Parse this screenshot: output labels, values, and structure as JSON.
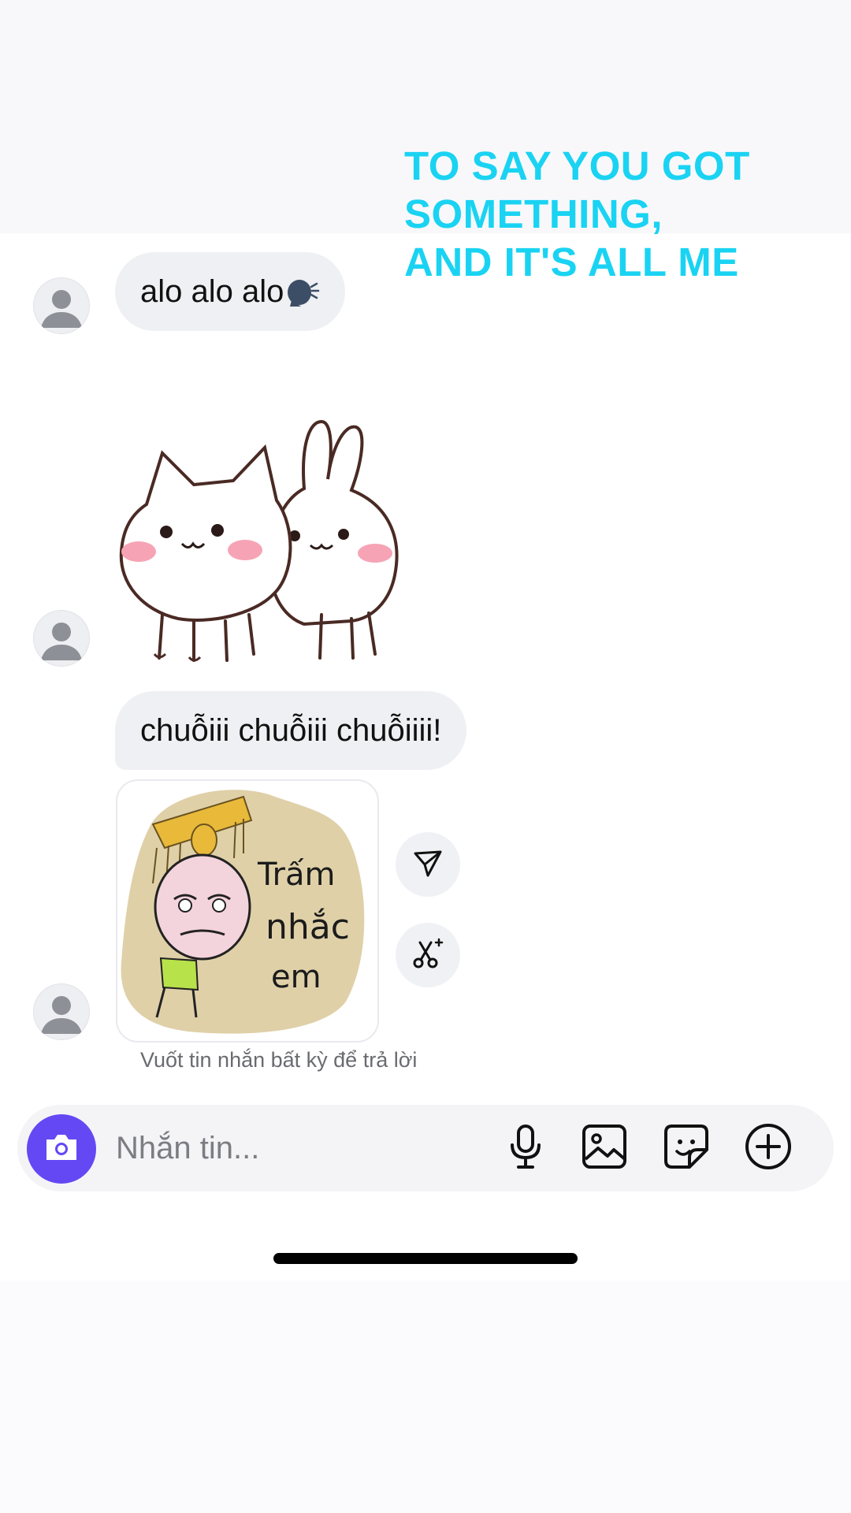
{
  "overlay_caption": {
    "line1": "TO SAY YOU GOT",
    "line2": "SOMETHING,",
    "line3": "AND IT'S ALL ME"
  },
  "messages": [
    {
      "type": "text",
      "text": "alo alo alo",
      "emoji": "speaking-head-emoji"
    },
    {
      "type": "sticker",
      "sticker": "cat-and-bunny-sticker"
    },
    {
      "type": "text",
      "text": "chuỗiii chuỗiii chuỗiiii!"
    },
    {
      "type": "sticker",
      "sticker": "character-sticker",
      "sticker_text_line1": "Trấm",
      "sticker_text_line2": "nhắc",
      "sticker_text_line3": "em"
    }
  ],
  "message_actions": {
    "share_icon": "send-icon",
    "remix_icon": "scissors-sparkle-icon"
  },
  "hint": "Vuốt tin nhắn bất kỳ để trả lời",
  "composer": {
    "placeholder": "Nhắn tin...",
    "camera_icon": "camera-icon",
    "tools": [
      "microphone-icon",
      "image-icon",
      "sticker-icon",
      "plus-circle-icon"
    ]
  },
  "colors": {
    "accent": "#6448f4",
    "caption": "#1ad3f2",
    "bubble": "#eff0f3"
  }
}
